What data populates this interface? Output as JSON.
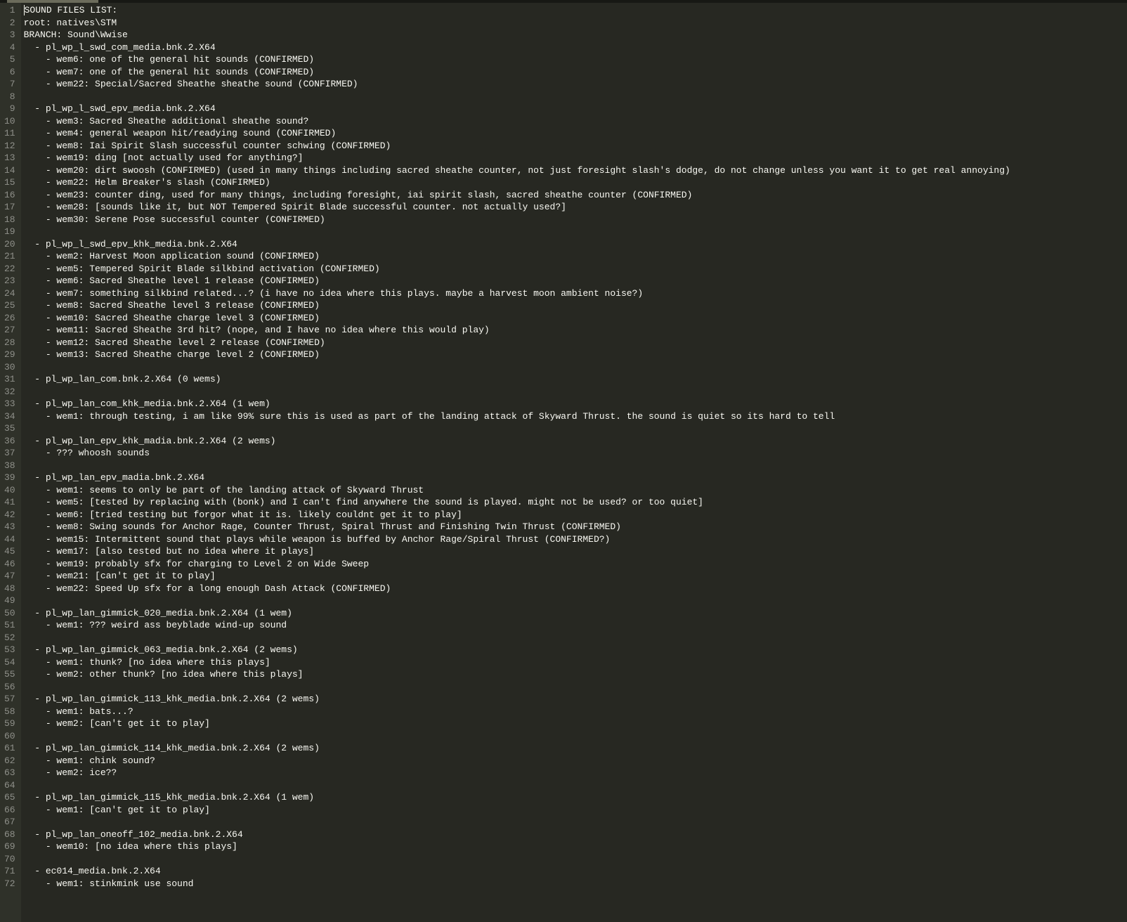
{
  "lines": [
    {
      "num": 1,
      "text": "SOUND FILES LIST:"
    },
    {
      "num": 2,
      "text": "root: natives\\STM"
    },
    {
      "num": 3,
      "text": "BRANCH: Sound\\Wwise"
    },
    {
      "num": 4,
      "text": "  - pl_wp_l_swd_com_media.bnk.2.X64"
    },
    {
      "num": 5,
      "text": "    - wem6: one of the general hit sounds (CONFIRMED)"
    },
    {
      "num": 6,
      "text": "    - wem7: one of the general hit sounds (CONFIRMED)"
    },
    {
      "num": 7,
      "text": "    - wem22: Special/Sacred Sheathe sheathe sound (CONFIRMED)"
    },
    {
      "num": 8,
      "text": ""
    },
    {
      "num": 9,
      "text": "  - pl_wp_l_swd_epv_media.bnk.2.X64"
    },
    {
      "num": 10,
      "text": "    - wem3: Sacred Sheathe additional sheathe sound?"
    },
    {
      "num": 11,
      "text": "    - wem4: general weapon hit/readying sound (CONFIRMED)"
    },
    {
      "num": 12,
      "text": "    - wem8: Iai Spirit Slash successful counter schwing (CONFIRMED)"
    },
    {
      "num": 13,
      "text": "    - wem19: ding [not actually used for anything?]"
    },
    {
      "num": 14,
      "text": "    - wem20: dirt swoosh (CONFIRMED) (used in many things including sacred sheathe counter, not just foresight slash's dodge, do not change unless you want it to get real annoying)"
    },
    {
      "num": 15,
      "text": "    - wem22: Helm Breaker's slash (CONFIRMED)"
    },
    {
      "num": 16,
      "text": "    - wem23: counter ding, used for many things, including foresight, iai spirit slash, sacred sheathe counter (CONFIRMED)"
    },
    {
      "num": 17,
      "text": "    - wem28: [sounds like it, but NOT Tempered Spirit Blade successful counter. not actually used?]"
    },
    {
      "num": 18,
      "text": "    - wem30: Serene Pose successful counter (CONFIRMED)"
    },
    {
      "num": 19,
      "text": ""
    },
    {
      "num": 20,
      "text": "  - pl_wp_l_swd_epv_khk_media.bnk.2.X64"
    },
    {
      "num": 21,
      "text": "    - wem2: Harvest Moon application sound (CONFIRMED)"
    },
    {
      "num": 22,
      "text": "    - wem5: Tempered Spirit Blade silkbind activation (CONFIRMED)"
    },
    {
      "num": 23,
      "text": "    - wem6: Sacred Sheathe level 1 release (CONFIRMED)"
    },
    {
      "num": 24,
      "text": "    - wem7: something silkbind related...? (i have no idea where this plays. maybe a harvest moon ambient noise?)"
    },
    {
      "num": 25,
      "text": "    - wem8: Sacred Sheathe level 3 release (CONFIRMED)"
    },
    {
      "num": 26,
      "text": "    - wem10: Sacred Sheathe charge level 3 (CONFIRMED)"
    },
    {
      "num": 27,
      "text": "    - wem11: Sacred Sheathe 3rd hit? (nope, and I have no idea where this would play)"
    },
    {
      "num": 28,
      "text": "    - wem12: Sacred Sheathe level 2 release (CONFIRMED)"
    },
    {
      "num": 29,
      "text": "    - wem13: Sacred Sheathe charge level 2 (CONFIRMED)"
    },
    {
      "num": 30,
      "text": ""
    },
    {
      "num": 31,
      "text": "  - pl_wp_lan_com.bnk.2.X64 (0 wems)"
    },
    {
      "num": 32,
      "text": ""
    },
    {
      "num": 33,
      "text": "  - pl_wp_lan_com_khk_media.bnk.2.X64 (1 wem)"
    },
    {
      "num": 34,
      "text": "    - wem1: through testing, i am like 99% sure this is used as part of the landing attack of Skyward Thrust. the sound is quiet so its hard to tell"
    },
    {
      "num": 35,
      "text": ""
    },
    {
      "num": 36,
      "text": "  - pl_wp_lan_epv_khk_madia.bnk.2.X64 (2 wems)"
    },
    {
      "num": 37,
      "text": "    - ??? whoosh sounds"
    },
    {
      "num": 38,
      "text": ""
    },
    {
      "num": 39,
      "text": "  - pl_wp_lan_epv_madia.bnk.2.X64"
    },
    {
      "num": 40,
      "text": "    - wem1: seems to only be part of the landing attack of Skyward Thrust"
    },
    {
      "num": 41,
      "text": "    - wem5: [tested by replacing with (bonk) and I can't find anywhere the sound is played. might not be used? or too quiet]"
    },
    {
      "num": 42,
      "text": "    - wem6: [tried testing but forgor what it is. likely couldnt get it to play]"
    },
    {
      "num": 43,
      "text": "    - wem8: Swing sounds for Anchor Rage, Counter Thrust, Spiral Thrust and Finishing Twin Thrust (CONFIRMED)"
    },
    {
      "num": 44,
      "text": "    - wem15: Intermittent sound that plays while weapon is buffed by Anchor Rage/Spiral Thrust (CONFIRMED?)"
    },
    {
      "num": 45,
      "text": "    - wem17: [also tested but no idea where it plays]"
    },
    {
      "num": 46,
      "text": "    - wem19: probably sfx for charging to Level 2 on Wide Sweep"
    },
    {
      "num": 47,
      "text": "    - wem21: [can't get it to play]"
    },
    {
      "num": 48,
      "text": "    - wem22: Speed Up sfx for a long enough Dash Attack (CONFIRMED)"
    },
    {
      "num": 49,
      "text": ""
    },
    {
      "num": 50,
      "text": "  - pl_wp_lan_gimmick_020_media.bnk.2.X64 (1 wem)"
    },
    {
      "num": 51,
      "text": "    - wem1: ??? weird ass beyblade wind-up sound"
    },
    {
      "num": 52,
      "text": ""
    },
    {
      "num": 53,
      "text": "  - pl_wp_lan_gimmick_063_media.bnk.2.X64 (2 wems)"
    },
    {
      "num": 54,
      "text": "    - wem1: thunk? [no idea where this plays]"
    },
    {
      "num": 55,
      "text": "    - wem2: other thunk? [no idea where this plays]"
    },
    {
      "num": 56,
      "text": ""
    },
    {
      "num": 57,
      "text": "  - pl_wp_lan_gimmick_113_khk_media.bnk.2.X64 (2 wems)"
    },
    {
      "num": 58,
      "text": "    - wem1: bats...?"
    },
    {
      "num": 59,
      "text": "    - wem2: [can't get it to play]"
    },
    {
      "num": 60,
      "text": ""
    },
    {
      "num": 61,
      "text": "  - pl_wp_lan_gimmick_114_khk_media.bnk.2.X64 (2 wems)"
    },
    {
      "num": 62,
      "text": "    - wem1: chink sound?"
    },
    {
      "num": 63,
      "text": "    - wem2: ice??"
    },
    {
      "num": 64,
      "text": ""
    },
    {
      "num": 65,
      "text": "  - pl_wp_lan_gimmick_115_khk_media.bnk.2.X64 (1 wem)"
    },
    {
      "num": 66,
      "text": "    - wem1: [can't get it to play]"
    },
    {
      "num": 67,
      "text": ""
    },
    {
      "num": 68,
      "text": "  - pl_wp_lan_oneoff_102_media.bnk.2.X64"
    },
    {
      "num": 69,
      "text": "    - wem10: [no idea where this plays]"
    },
    {
      "num": 70,
      "text": ""
    },
    {
      "num": 71,
      "text": "  - ec014_media.bnk.2.X64"
    },
    {
      "num": 72,
      "text": "    - wem1: stinkmink use sound"
    }
  ]
}
